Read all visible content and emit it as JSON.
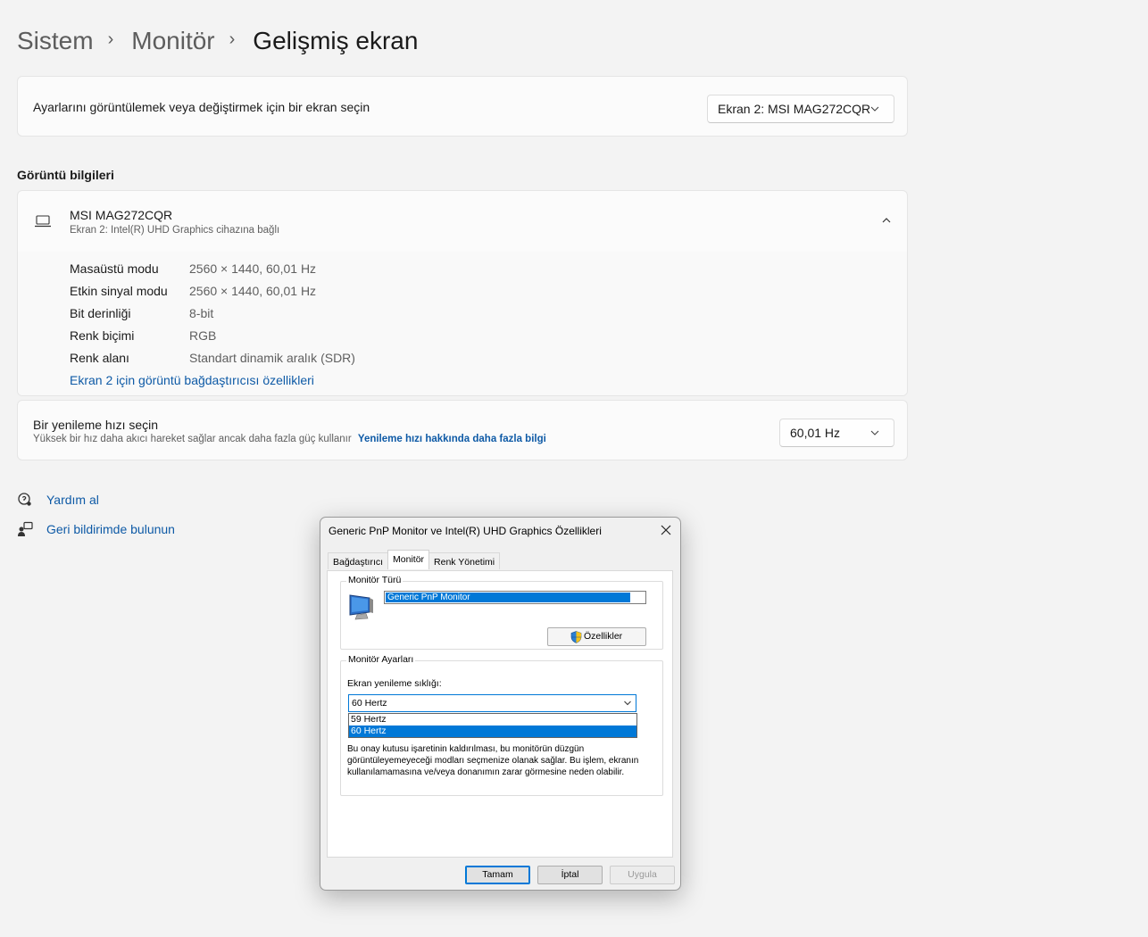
{
  "breadcrumb": {
    "parent1": "Sistem",
    "parent2": "Monitör",
    "current": "Gelişmiş ekran"
  },
  "display_select": {
    "label": "Ayarlarını görüntülemek veya değiştirmek için bir ekran seçin",
    "value": "Ekran 2: MSI MAG272CQR"
  },
  "display_info": {
    "section_title": "Görüntü bilgileri",
    "monitor_name": "MSI MAG272CQR",
    "monitor_sub": "Ekran 2: Intel(R) UHD Graphics cihazına bağlı",
    "rows": [
      {
        "label": "Masaüstü modu",
        "value": "2560 × 1440, 60,01 Hz"
      },
      {
        "label": "Etkin sinyal modu",
        "value": "2560 × 1440, 60,01 Hz"
      },
      {
        "label": "Bit derinliği",
        "value": "8-bit"
      },
      {
        "label": "Renk biçimi",
        "value": "RGB"
      },
      {
        "label": "Renk alanı",
        "value": "Standart dinamik aralık (SDR)"
      }
    ],
    "adapter_link": "Ekran 2 için görüntü bağdaştırıcısı özellikleri"
  },
  "refresh": {
    "title": "Bir yenileme hızı seçin",
    "desc": "Yüksek bir hız daha akıcı hareket sağlar ancak daha fazla güç kullanır",
    "link": "Yenileme hızı hakkında daha fazla bilgi",
    "value": "60,01 Hz"
  },
  "help": {
    "get_help": "Yardım al",
    "feedback": "Geri bildirimde bulunun"
  },
  "dialog": {
    "title": "Generic PnP Monitor ve Intel(R) UHD Graphics Özellikleri",
    "tabs": [
      "Bağdaştırıcı",
      "Monitör",
      "Renk Yönetimi"
    ],
    "monitor_type_legend": "Monitör Türü",
    "monitor_type_value": "Generic PnP Monitor",
    "properties_button": "Özellikler",
    "monitor_settings_legend": "Monitör Ayarları",
    "refresh_label": "Ekran yenileme sıklığı:",
    "refresh_selected": "60 Hertz",
    "refresh_options": [
      "59 Hertz",
      "60 Hertz"
    ],
    "warning_lines": [
      "Bu onay kutusu işaretinin kaldırılması, bu monitörün düzgün",
      "görüntüleyemeyeceği modları seçmenize olanak sağlar. Bu işlem, ekranın",
      "kullanılamamasına ve/veya donanımın zarar görmesine neden olabilir."
    ],
    "ok": "Tamam",
    "cancel": "İptal",
    "apply": "Uygula"
  },
  "colors": {
    "accent": "#0078d7",
    "link": "#0e5aa6",
    "selection": "#0078d7"
  }
}
